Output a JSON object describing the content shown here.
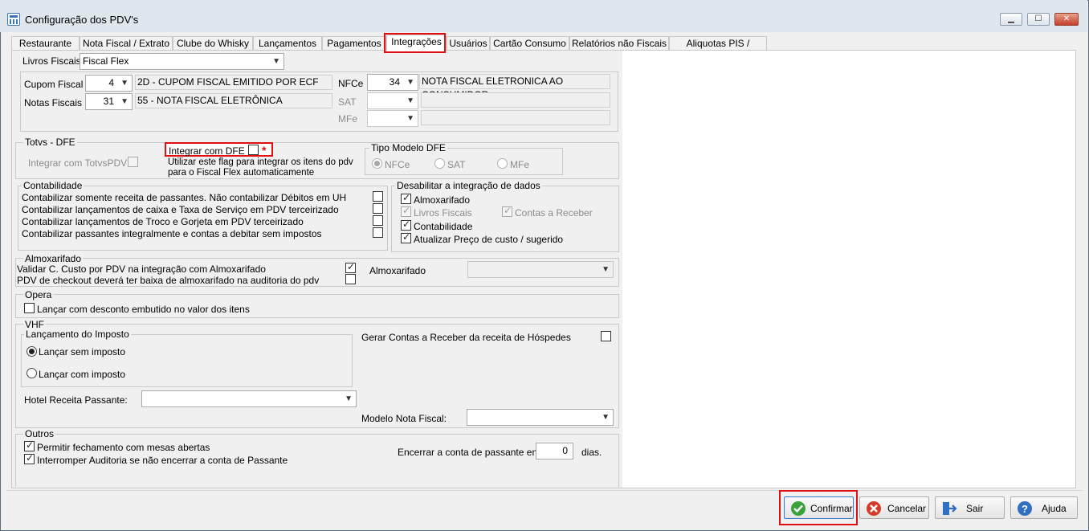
{
  "window": {
    "title": "Configuração dos PDV's"
  },
  "title_buttons": {
    "minimize": "▁",
    "maximize": "☐",
    "close": "✕"
  },
  "tabs": [
    "Restaurante",
    "Nota Fiscal / Extrato",
    "Clube do Whisky",
    "Lançamentos",
    "Pagamentos",
    "Integrações",
    "Usuários",
    "Cartão Consumo",
    "Relatórios não Fiscais",
    "Aliquotas PIS / COFINS"
  ],
  "active_tab": "Integrações",
  "livros": {
    "label": "Livros Fiscais",
    "value": "Fiscal Flex",
    "cupom_label": "Cupom Fiscal",
    "cupom_code": "4",
    "cupom_desc": "2D - CUPOM FISCAL EMITIDO POR ECF",
    "notas_label": "Notas Fiscais",
    "notas_code": "31",
    "notas_desc": "55 - NOTA FISCAL ELETRÔNICA",
    "nfce_label": "NFCe",
    "nfce_code": "34",
    "nfce_desc": "NOTA FISCAL ELETRONICA AO CONSUMIDOR",
    "sat_label": "SAT",
    "mfe_label": "MFe"
  },
  "totvs": {
    "legend": "Totvs - DFE",
    "integrar_totvspdv": "Integrar com TotvsPDV",
    "integrar_dfe": "Integrar com  DFE",
    "asterisk": "*",
    "hint_line1": "Utilizar este flag para integrar os itens do pdv",
    "hint_line2": "para o Fiscal Flex automaticamente",
    "tipo_legend": "Tipo Modelo DFE",
    "radio_nfce": "NFCe",
    "radio_sat": "SAT",
    "radio_mfe": "MFe",
    "selected": "NFCe"
  },
  "contabilidade": {
    "legend": "Contabilidade",
    "items": [
      "Contabilizar somente receita de passantes. Não contabilizar Débitos em UH",
      "Contabilizar lançamentos de caixa e Taxa de Serviço em PDV terceirizado",
      "Contabilizar lançamentos de Troco e Gorjeta em PDV terceirizado",
      "Contabilizar passantes integralmente e contas a debitar sem impostos"
    ]
  },
  "desabilitar": {
    "legend": "Desabilitar a integração de dados",
    "almoxarifado": "Almoxarifado",
    "livros_fiscais": "Livros Fiscais",
    "contas_receber": "Contas a Receber",
    "contabilidade": "Contabilidade",
    "atualizar_preco": "Atualizar Preço de custo / sugerido"
  },
  "almox": {
    "legend": "Almoxarifado",
    "validar": "Validar C. Custo por PDV na integração com Almoxarifado",
    "checkout": "PDV de checkout deverá ter baixa de almoxarifado na auditoria do pdv",
    "label": "Almoxarifado",
    "value": ""
  },
  "opera": {
    "legend": "Opera",
    "lancar_desconto": "Lançar com desconto embutido no valor dos itens"
  },
  "vhf": {
    "legend": "VHF",
    "lanc_legend": "Lançamento do Imposto",
    "sem_imposto": "Lançar sem imposto",
    "com_imposto": "Lançar com imposto",
    "selected": "Lançar sem imposto",
    "gerar_contas": "Gerar Contas a Receber da receita de Hóspedes",
    "hotel_label": "Hotel Receita Passante:",
    "hotel_value": "",
    "modelo_label": "Modelo Nota Fiscal:",
    "modelo_value": ""
  },
  "outros": {
    "legend": "Outros",
    "permitir": "Permitir fechamento com mesas abertas",
    "interromper": "Interromper Auditoria se não encerrar a conta de Passante",
    "encerrar_label": "Encerrar a conta de passante em",
    "encerrar_value": "0",
    "dias": "dias."
  },
  "buttons": {
    "confirmar": "Confirmar",
    "cancelar": "Cancelar",
    "sair": "Sair",
    "ajuda": "Ajuda"
  },
  "icons": {
    "app": "pdv-config-icon",
    "confirmar": "check-circle-icon",
    "cancelar": "cancel-circle-icon",
    "sair": "exit-door-icon",
    "ajuda": "help-circle-icon"
  },
  "colors": {
    "highlight": "#e01010",
    "window_bg": "#f0f0f0",
    "title_bg": "#dfe6ee",
    "confirm_green": "#3aa23a",
    "cancel_red": "#d43b2a",
    "help_blue": "#2f6fc4"
  }
}
